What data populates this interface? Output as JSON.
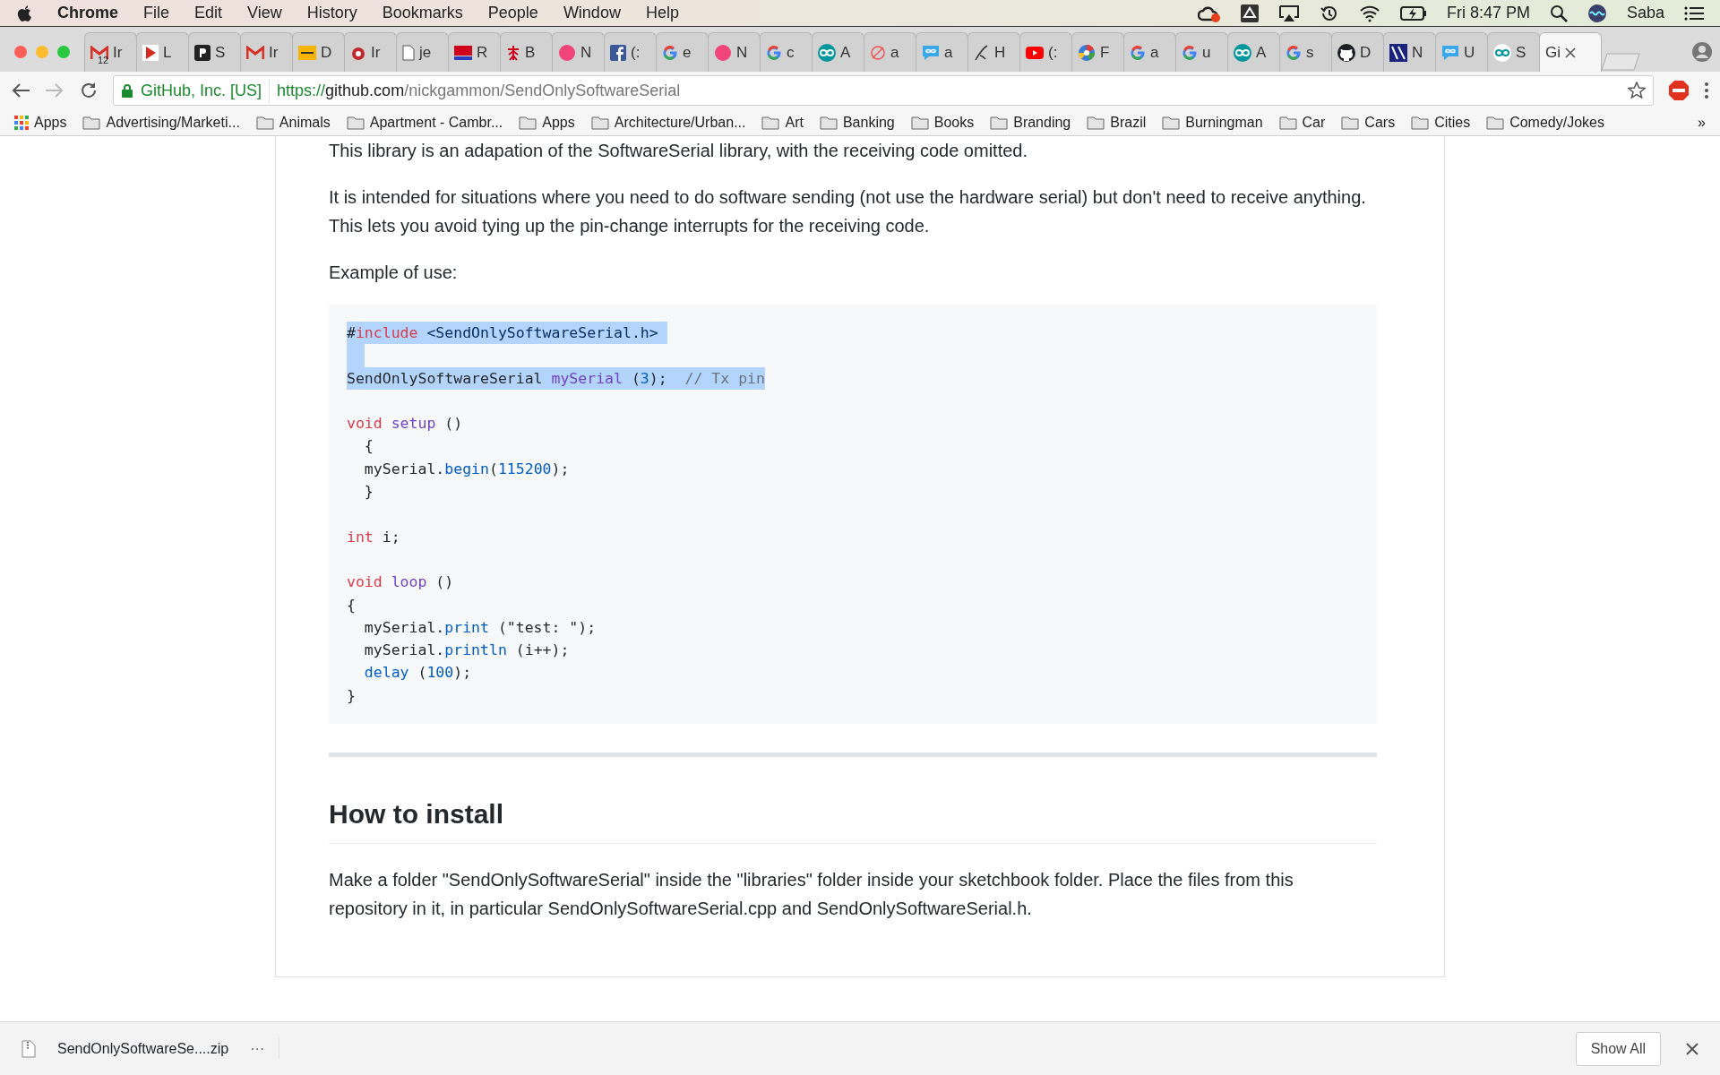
{
  "menu_bar": {
    "app": "Chrome",
    "items": [
      "File",
      "Edit",
      "View",
      "History",
      "Bookmarks",
      "People",
      "Window",
      "Help"
    ],
    "clock": "Fri 8:47 PM",
    "user": "Saba"
  },
  "tabs": [
    {
      "kind": "gmail",
      "label": "Ir",
      "badge": "12",
      "selected": false
    },
    {
      "kind": "red-arrow",
      "label": "L",
      "selected": false
    },
    {
      "kind": "p-logo",
      "label": "S",
      "selected": false
    },
    {
      "kind": "gmail",
      "label": "Ir",
      "selected": false
    },
    {
      "kind": "wbur",
      "label": "D",
      "selected": false
    },
    {
      "kind": "bug",
      "label": "Ir",
      "selected": false
    },
    {
      "kind": "doc",
      "label": "je",
      "selected": false
    },
    {
      "kind": "sp",
      "label": "R",
      "selected": false
    },
    {
      "kind": "red-figure",
      "label": "B",
      "selected": false
    },
    {
      "kind": "pink-dot",
      "label": "N",
      "selected": false
    },
    {
      "kind": "facebook",
      "label": "(:",
      "selected": false
    },
    {
      "kind": "google",
      "label": "e",
      "selected": false
    },
    {
      "kind": "pink-dot",
      "label": "N",
      "selected": false
    },
    {
      "kind": "google",
      "label": "c",
      "selected": false
    },
    {
      "kind": "infinity",
      "label": "A",
      "selected": false
    },
    {
      "kind": "no-sign",
      "label": "a",
      "selected": false
    },
    {
      "kind": "chat",
      "label": "a",
      "selected": false
    },
    {
      "kind": "pen",
      "label": "H",
      "selected": false
    },
    {
      "kind": "youtube",
      "label": "(:",
      "selected": false
    },
    {
      "kind": "pinwheel",
      "label": "F",
      "selected": false
    },
    {
      "kind": "google",
      "label": "a",
      "selected": false
    },
    {
      "kind": "google",
      "label": "u",
      "selected": false
    },
    {
      "kind": "infinity",
      "label": "A",
      "selected": false
    },
    {
      "kind": "google",
      "label": "s",
      "selected": false
    },
    {
      "kind": "github",
      "label": "D",
      "selected": false
    },
    {
      "kind": "pjrc",
      "label": "N",
      "selected": false
    },
    {
      "kind": "chat",
      "label": "U",
      "selected": false
    },
    {
      "kind": "infinity-white",
      "label": "S",
      "selected": false
    },
    {
      "kind": "none",
      "label": "Gi",
      "selected": true
    }
  ],
  "address_bar": {
    "site_identity": "GitHub, Inc. [US]",
    "url_scheme": "https://",
    "url_host": "github.com",
    "url_path": "/nickgammon/SendOnlySoftwareSerial"
  },
  "bookmarks": [
    {
      "kind": "apps",
      "label": "Apps"
    },
    {
      "kind": "folder",
      "label": "Advertising/Marketi..."
    },
    {
      "kind": "folder",
      "label": "Animals"
    },
    {
      "kind": "folder",
      "label": "Apartment - Cambr..."
    },
    {
      "kind": "folder",
      "label": "Apps"
    },
    {
      "kind": "folder",
      "label": "Architecture/Urban..."
    },
    {
      "kind": "folder",
      "label": "Art"
    },
    {
      "kind": "folder",
      "label": "Banking"
    },
    {
      "kind": "folder",
      "label": "Books"
    },
    {
      "kind": "folder",
      "label": "Branding"
    },
    {
      "kind": "folder",
      "label": "Brazil"
    },
    {
      "kind": "folder",
      "label": "Burningman"
    },
    {
      "kind": "folder",
      "label": "Car"
    },
    {
      "kind": "folder",
      "label": "Cars"
    },
    {
      "kind": "folder",
      "label": "Cities"
    },
    {
      "kind": "folder",
      "label": "Comedy/Jokes"
    }
  ],
  "bookmarks_overflow": "»",
  "readme": {
    "paragraphs": [
      "This library is an adapation of the SoftwareSerial library, with the receiving code omitted.",
      "It is intended for situations where you need to do software sending (not use the hardware serial) but don't need to receive anything. This lets you avoid tying up the pin-change interrupts for the receiving code.",
      "Example of use:"
    ],
    "code_lines": [
      {
        "selected": true,
        "tokens": [
          {
            "kind": "plain",
            "text": "#"
          },
          {
            "kind": "keyword",
            "text": "include"
          },
          {
            "kind": "string",
            "text": " <SendOnlySoftwareSerial.h> "
          }
        ]
      },
      {
        "selected": true
      },
      {
        "selected": true,
        "tokens": [
          {
            "kind": "plain",
            "text": "SendOnlySoftwareSerial "
          },
          {
            "kind": "entity",
            "text": "mySerial"
          },
          {
            "kind": "plain",
            "text": " ("
          },
          {
            "kind": "number",
            "text": "3"
          },
          {
            "kind": "plain",
            "text": ");  "
          },
          {
            "kind": "comment",
            "text": "// Tx pin"
          }
        ]
      },
      {
        "selected": false
      },
      {
        "selected": false,
        "tokens": [
          {
            "kind": "keyword",
            "text": "void "
          },
          {
            "kind": "entity",
            "text": "setup"
          },
          {
            "kind": "plain",
            "text": " ()"
          }
        ]
      },
      {
        "selected": false,
        "tokens": [
          {
            "kind": "plain",
            "text": "  {"
          }
        ]
      },
      {
        "selected": false,
        "tokens": [
          {
            "kind": "plain",
            "text": "  mySerial."
          },
          {
            "kind": "function",
            "text": "begin"
          },
          {
            "kind": "plain",
            "text": "("
          },
          {
            "kind": "number",
            "text": "115200"
          },
          {
            "kind": "plain",
            "text": ");"
          }
        ]
      },
      {
        "selected": false,
        "tokens": [
          {
            "kind": "plain",
            "text": "  }"
          }
        ]
      },
      {
        "selected": false
      },
      {
        "selected": false,
        "tokens": [
          {
            "kind": "keyword",
            "text": "int"
          },
          {
            "kind": "plain",
            "text": " i;"
          }
        ]
      },
      {
        "selected": false
      },
      {
        "selected": false,
        "tokens": [
          {
            "kind": "keyword",
            "text": "void "
          },
          {
            "kind": "entity",
            "text": "loop"
          },
          {
            "kind": "plain",
            "text": " ()"
          }
        ]
      },
      {
        "selected": false,
        "tokens": [
          {
            "kind": "plain",
            "text": "{"
          }
        ]
      },
      {
        "selected": false,
        "tokens": [
          {
            "kind": "plain",
            "text": "  mySerial."
          },
          {
            "kind": "function",
            "text": "print"
          },
          {
            "kind": "plain",
            "text": " (\"test: \");"
          }
        ]
      },
      {
        "selected": false,
        "tokens": [
          {
            "kind": "plain",
            "text": "  mySerial."
          },
          {
            "kind": "function",
            "text": "println"
          },
          {
            "kind": "plain",
            "text": " (i++);"
          }
        ]
      },
      {
        "selected": false,
        "tokens": [
          {
            "kind": "function",
            "text": "  delay"
          },
          {
            "kind": "plain",
            "text": " ("
          },
          {
            "kind": "number",
            "text": "100"
          },
          {
            "kind": "plain",
            "text": ");"
          }
        ]
      },
      {
        "selected": false,
        "tokens": [
          {
            "kind": "plain",
            "text": "}"
          }
        ]
      }
    ],
    "heading": "How to install",
    "install_paragraph": "Make a folder \"SendOnlySoftwareSerial\" inside the \"libraries\" folder inside your sketchbook folder. Place the files from this repository in it, in particular SendOnlySoftwareSerial.cpp and SendOnlySoftwareSerial.h."
  },
  "download_bar": {
    "file": "SendOnlySoftwareSe....zip",
    "more": "···",
    "show_all": "Show All"
  }
}
